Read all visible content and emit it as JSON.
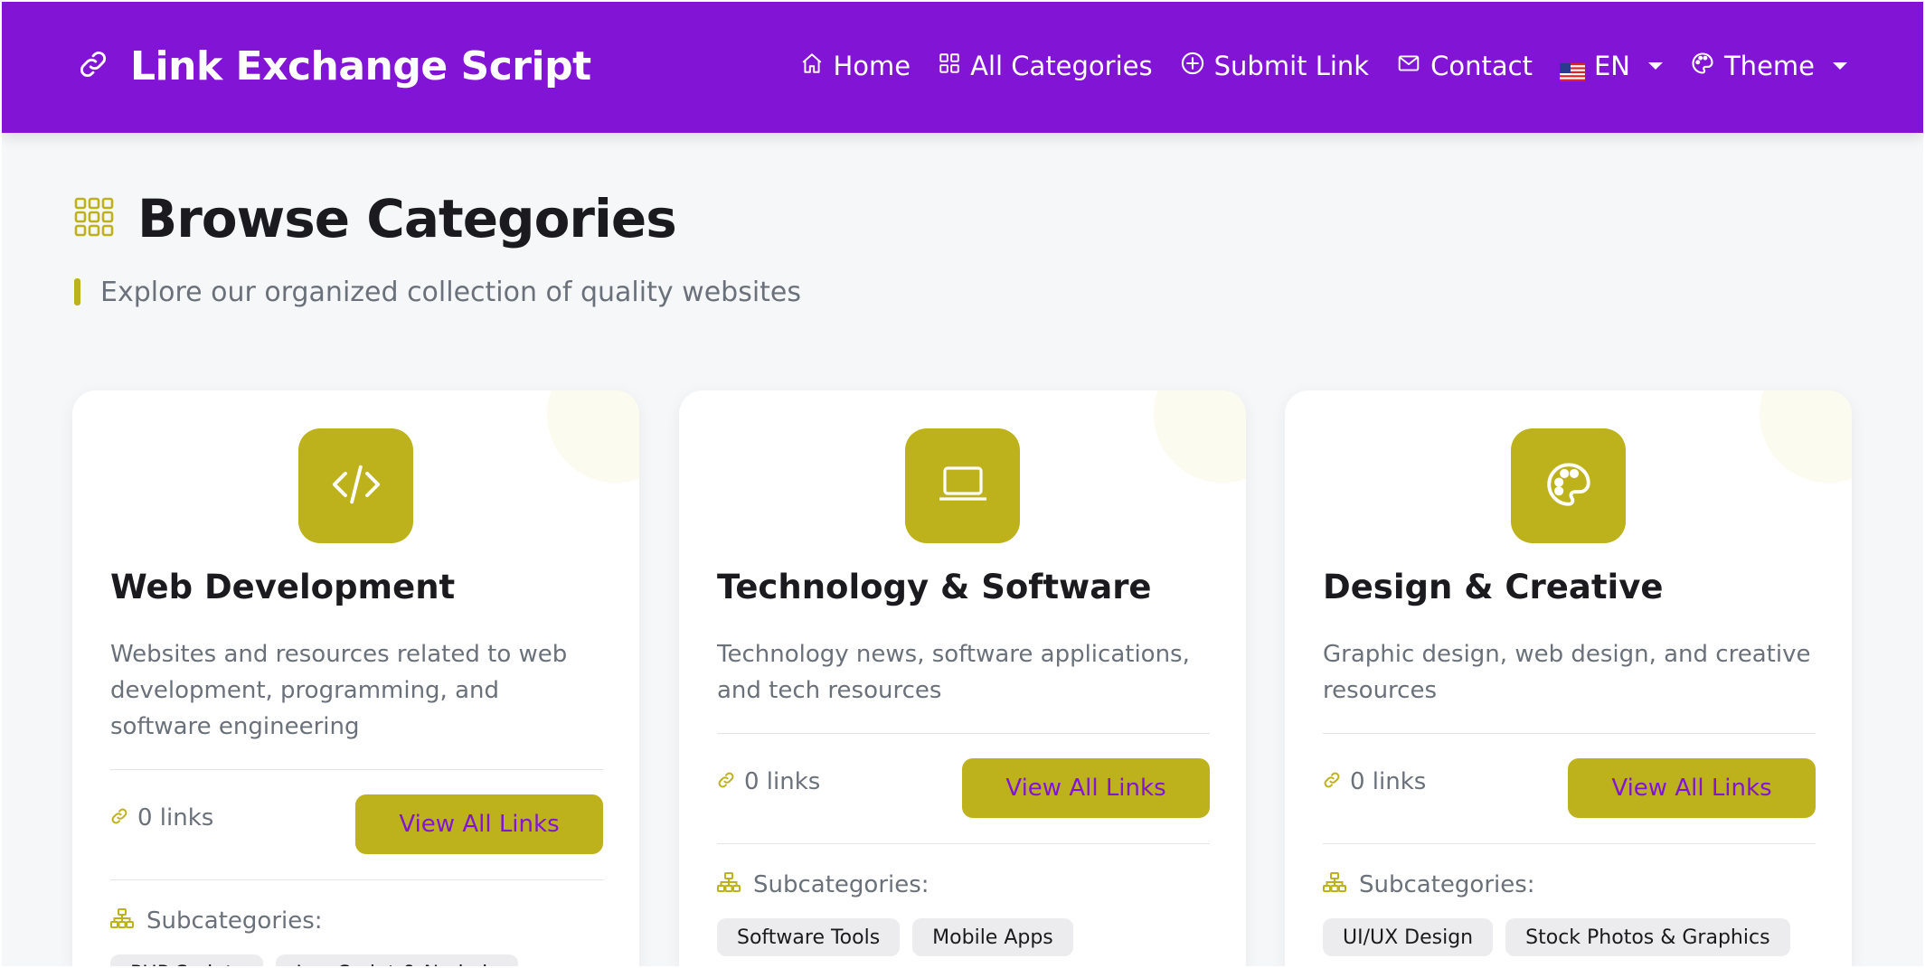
{
  "navbar": {
    "brand": "Link Exchange Script",
    "items": [
      {
        "label": "Home",
        "icon": "house-icon"
      },
      {
        "label": "All Categories",
        "icon": "grid-icon"
      },
      {
        "label": "Submit Link",
        "icon": "plus-circle-icon"
      },
      {
        "label": "Contact",
        "icon": "envelope-icon"
      }
    ],
    "language": "EN",
    "theme": "Theme"
  },
  "header": {
    "title": "Browse Categories",
    "subtitle": "Explore our organized collection of quality websites"
  },
  "categories": [
    {
      "title": "Web Development",
      "icon": "code-icon",
      "description": "Websites and resources related to web development, programming, and software engineering",
      "links": "0 links",
      "button": "View All Links",
      "subcategories_label": "Subcategories:",
      "subcategories": [
        "PHP Scripts",
        "JavaScript & Node.js"
      ]
    },
    {
      "title": "Technology & Software",
      "icon": "laptop-icon",
      "description": "Technology news, software applications, and tech resources",
      "links": "0 links",
      "button": "View All Links",
      "subcategories_label": "Subcategories:",
      "subcategories": [
        "Software Tools",
        "Mobile Apps"
      ]
    },
    {
      "title": "Design & Creative",
      "icon": "palette-icon",
      "description": "Graphic design, web design, and creative resources",
      "links": "0 links",
      "button": "View All Links",
      "subcategories_label": "Subcategories:",
      "subcategories": [
        "UI/UX Design",
        "Stock Photos & Graphics"
      ]
    }
  ],
  "colors": {
    "brand": "#8214d6",
    "accent": "#bdb21c",
    "background": "#f6f7f9"
  }
}
